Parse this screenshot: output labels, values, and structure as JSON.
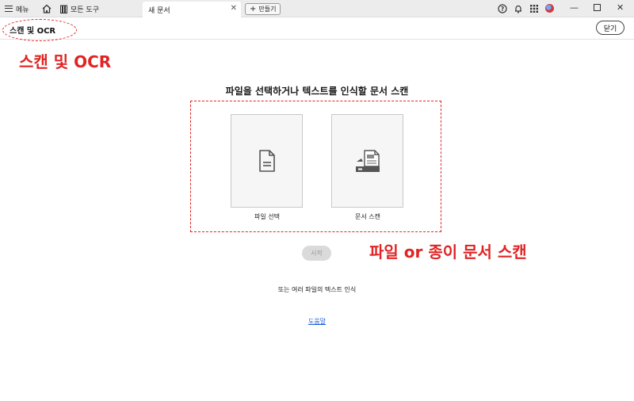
{
  "titlebar": {
    "menu_label": "메뉴",
    "tools_tab_label": "모든 도구",
    "doc_tab_label": "새 문서",
    "new_button_label": "만들기"
  },
  "header": {
    "title": "스캔 및 OCR",
    "close_label": "닫기"
  },
  "main": {
    "heading": "파일을 선택하거나 텍스트를 인식할 문서 스캔",
    "options": [
      {
        "label": "파일 선택",
        "icon": "file-icon"
      },
      {
        "label": "문서 스캔",
        "icon": "scanner-icon"
      }
    ],
    "start_label": "시작",
    "multi_ocr_label": "또는 여러 파일의 텍스트 인식",
    "help_label": "도움말"
  },
  "annotations": {
    "title_note": "스캔 및 OCR",
    "options_note": "파일 or 종이 문서 스캔",
    "color": "#e02424"
  },
  "colors": {
    "accent_link": "#1a5bd6",
    "titlebar_bg": "#ececec",
    "card_bg": "#f6f6f6"
  }
}
